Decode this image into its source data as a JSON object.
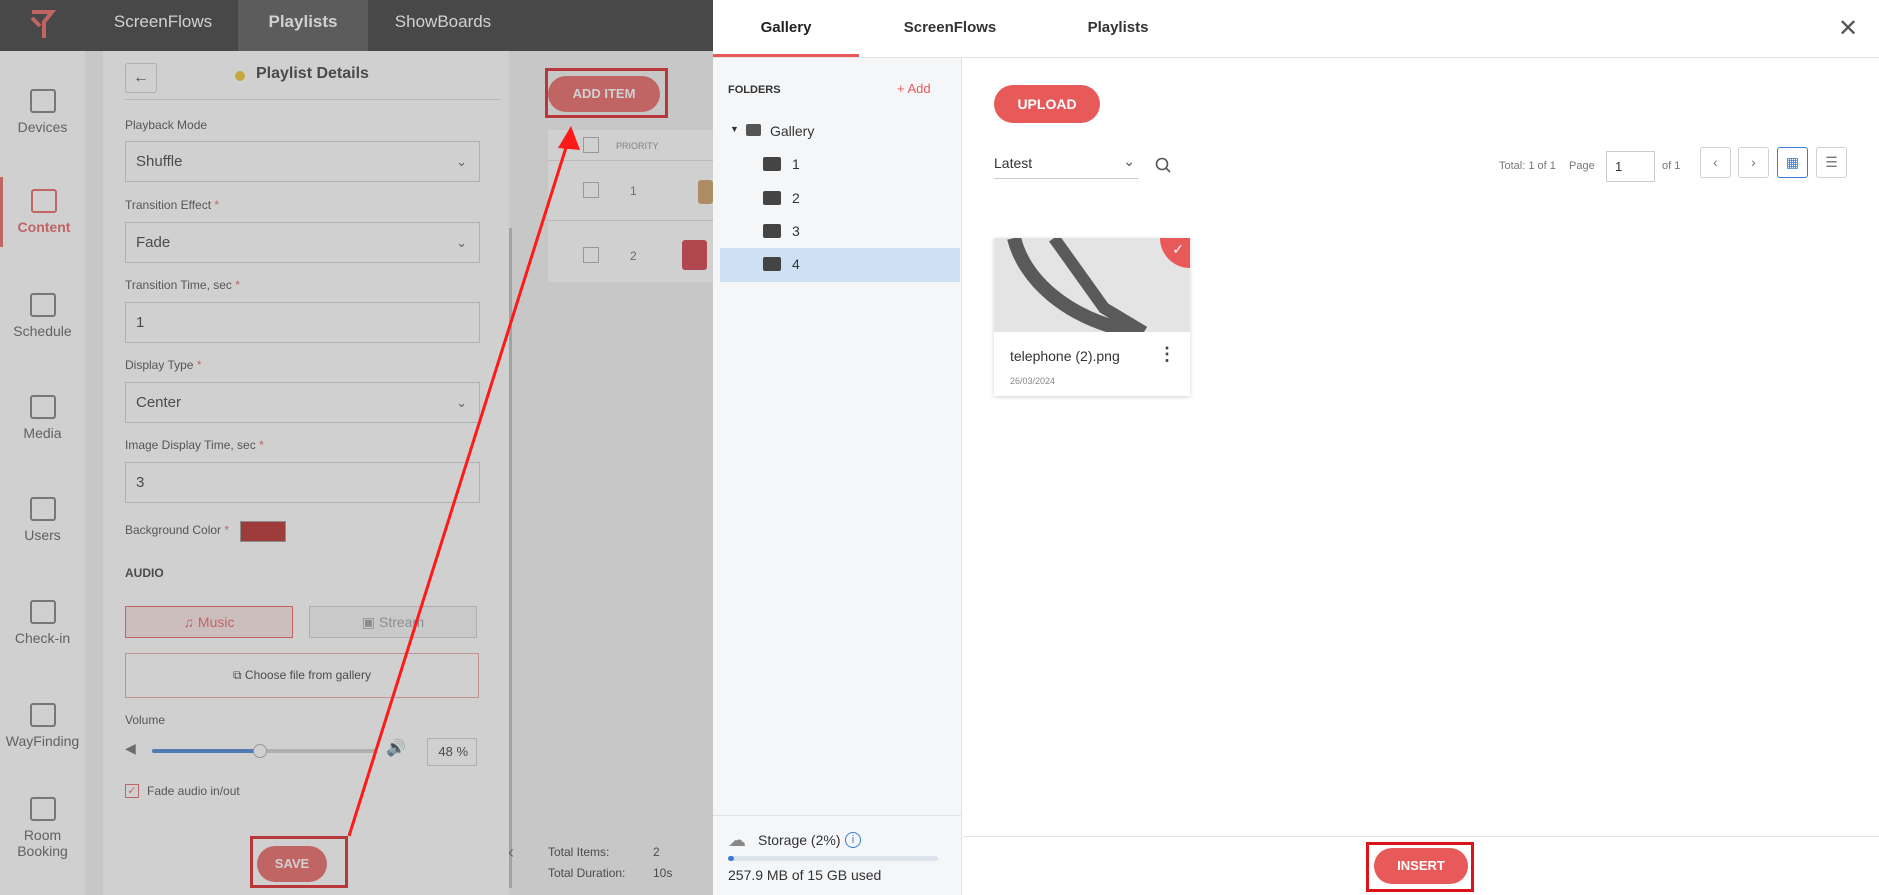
{
  "topnav": {
    "tabs": [
      "ScreenFlows",
      "Playlists",
      "ShowBoards"
    ],
    "active": "Playlists"
  },
  "sidebar": {
    "items": [
      {
        "label": "Devices",
        "icon": "monitor-icon"
      },
      {
        "label": "Content",
        "icon": "content-icon",
        "active": true
      },
      {
        "label": "Schedule",
        "icon": "calendar-icon"
      },
      {
        "label": "Media",
        "icon": "folder-icon"
      },
      {
        "label": "Users",
        "icon": "users-icon"
      },
      {
        "label": "Check-in",
        "icon": "checkin-icon"
      },
      {
        "label": "WayFinding",
        "icon": "wayfinding-icon"
      },
      {
        "label": "Room Booking",
        "icon": "room-booking-icon"
      }
    ]
  },
  "playlist": {
    "title": "Playlist Details",
    "playback_mode_label": "Playback Mode",
    "playback_mode": "Shuffle",
    "transition_effect_label": "Transition Effect",
    "transition_effect": "Fade",
    "transition_time_label": "Transition Time, sec",
    "transition_time": "1",
    "display_type_label": "Display Type",
    "display_type": "Center",
    "image_display_time_label": "Image Display Time, sec",
    "image_display_time": "3",
    "background_color_label": "Background Color",
    "background_color": "#b31b1b",
    "audio_heading": "AUDIO",
    "music_label": "Music",
    "stream_label": "Stream",
    "choose_file_label": "Choose file from gallery",
    "volume_label": "Volume",
    "volume_value": "48",
    "volume_unit": "%",
    "volume_fraction": 0.48,
    "fade_label": "Fade audio in/out",
    "required_mark": "*",
    "save_label": "SAVE"
  },
  "items_table": {
    "add_item_label": "ADD ITEM",
    "priority_header": "PRIORITY",
    "rows": [
      {
        "priority": "1"
      },
      {
        "priority": "2"
      }
    ],
    "total_items_label": "Total Items:",
    "total_items": "2",
    "total_duration_label": "Total Duration:",
    "total_duration": "10s"
  },
  "modal": {
    "tabs": [
      "Gallery",
      "ScreenFlows",
      "Playlists"
    ],
    "active_tab": "Gallery",
    "folders_header": "FOLDERS",
    "add_label": "Add",
    "root_folder": "Gallery",
    "folders": [
      "1",
      "2",
      "3",
      "4"
    ],
    "selected_folder": "4",
    "upload_label": "UPLOAD",
    "sort_value": "Latest",
    "total_label": "Total: 1 of 1",
    "page_label": "Page",
    "page_value": "1",
    "of_label": "of 1",
    "file": {
      "name": "telephone (2).png",
      "date": "26/03/2024"
    },
    "storage_label": "Storage (2%)",
    "storage_used": "257.9 MB of 15 GB used",
    "storage_fraction": 0.02,
    "insert_label": "INSERT"
  },
  "colors": {
    "accent": "#e85a5a",
    "highlight_box": "#d9141a",
    "selected_folder": "#cfe0f5"
  }
}
